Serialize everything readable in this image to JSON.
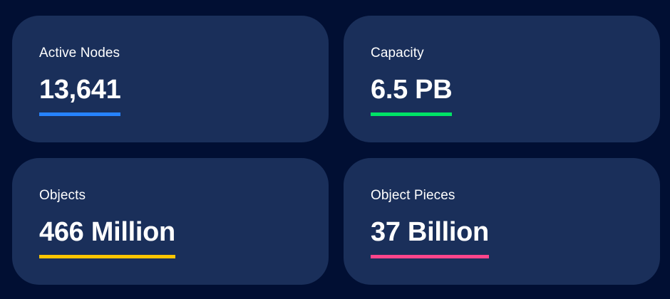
{
  "stats": [
    {
      "label": "Active Nodes",
      "value": "13,641",
      "accent": "#2683ff"
    },
    {
      "label": "Capacity",
      "value": "6.5 PB",
      "accent": "#00e366"
    },
    {
      "label": "Objects",
      "value": "466 Million",
      "accent": "#ffc600"
    },
    {
      "label": "Object Pieces",
      "value": "37 Billion",
      "accent": "#ff458b"
    }
  ]
}
